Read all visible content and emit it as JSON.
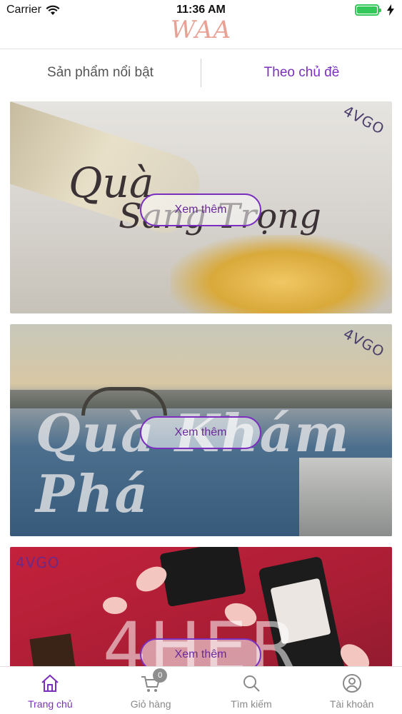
{
  "status_bar": {
    "carrier": "Carrier",
    "time": "11:36 AM"
  },
  "header": {
    "logo": "WAA"
  },
  "tabs": [
    {
      "label": "Sản phẩm nổi bật",
      "active": false
    },
    {
      "label": "Theo chủ đề",
      "active": true
    }
  ],
  "cards": [
    {
      "brand": "4VGO",
      "title_line1": "Quà",
      "title_line2": "Sang Trọng",
      "button": "Xem thêm"
    },
    {
      "brand": "4VGO",
      "title": "Quà Khám Phá",
      "button": "Xem thêm"
    },
    {
      "brand": "4VGO",
      "title": "4HER",
      "button": "Xem thêm"
    }
  ],
  "tabbar": {
    "items": [
      {
        "label": "Trang chủ",
        "icon": "home-icon",
        "active": true
      },
      {
        "label": "Giỏ hàng",
        "icon": "cart-icon",
        "badge": "0"
      },
      {
        "label": "Tìm kiếm",
        "icon": "search-icon"
      },
      {
        "label": "Tài khoản",
        "icon": "account-icon"
      }
    ]
  },
  "colors": {
    "accent": "#7b2fbe",
    "logo": "#e8a295",
    "battery": "#34c759"
  }
}
